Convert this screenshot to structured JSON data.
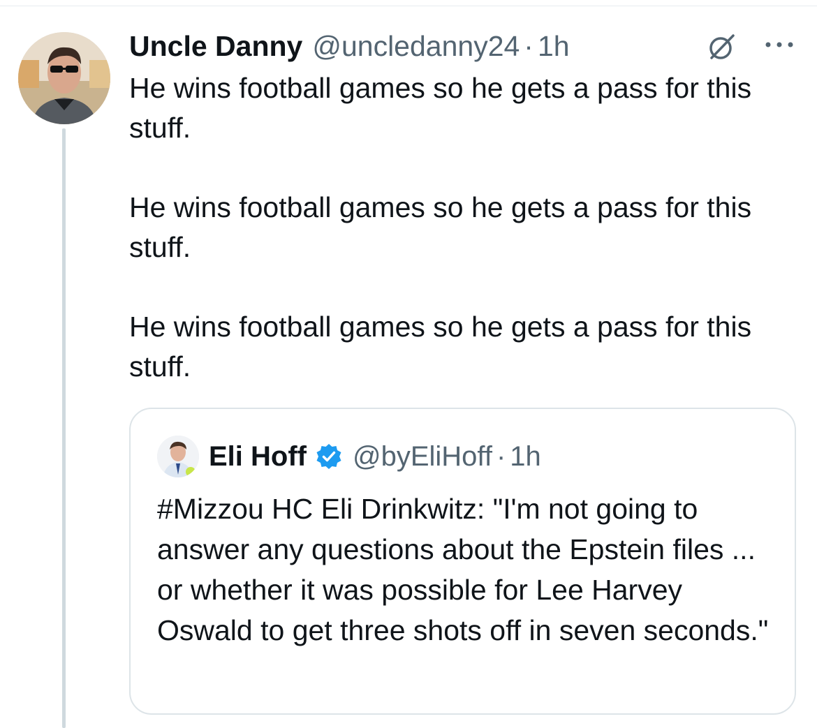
{
  "tweet": {
    "author": {
      "display_name": "Uncle Danny",
      "handle": "@uncledanny24",
      "separator": "·",
      "time": "1h"
    },
    "paragraphs": [
      "He wins football games so he gets a pass for this stuff.",
      "He wins football games so he gets a pass for this stuff.",
      "He wins football games so he gets a pass for this stuff."
    ],
    "icons": {
      "grok": "grok-icon",
      "more": "more-options-icon"
    }
  },
  "quote": {
    "author": {
      "display_name": "Eli Hoff",
      "verified": true,
      "handle": "@byEliHoff",
      "separator": "·",
      "time": "1h"
    },
    "text": "#Mizzou HC Eli Drinkwitz: \"I'm not going to answer any questions about the Epstein files ... or whether it was possible for Lee Harvey Oswald to get three shots off in seven seconds.\""
  },
  "colors": {
    "text": "#0f1419",
    "secondary": "#536471",
    "verified": "#1d9bf0",
    "thread_line": "#cfd9de",
    "card_border": "#dde4e8"
  }
}
